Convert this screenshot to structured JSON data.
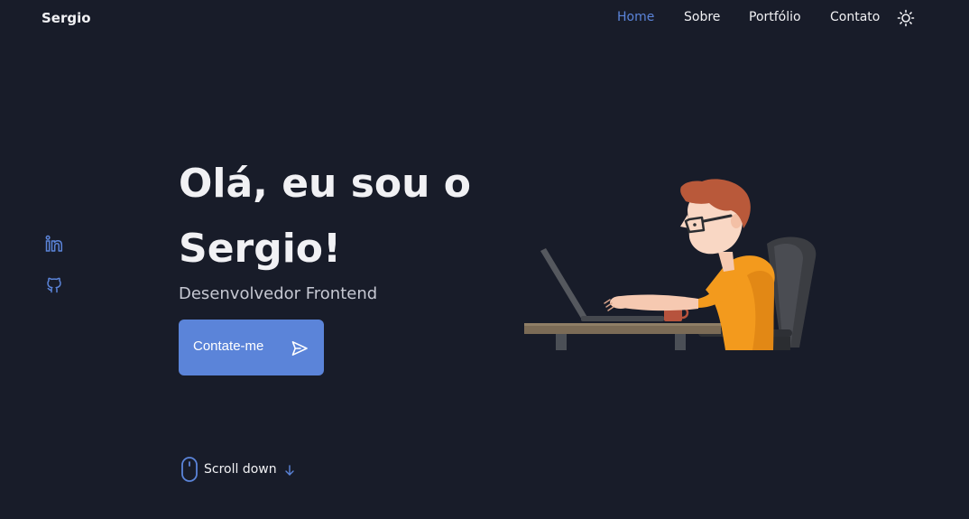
{
  "header": {
    "logo": "Sergio",
    "nav": [
      {
        "label": "Home",
        "active": true
      },
      {
        "label": "Sobre",
        "active": false
      },
      {
        "label": "Portfólio",
        "active": false
      },
      {
        "label": "Contato",
        "active": false
      }
    ],
    "theme_icon": "sun-icon"
  },
  "social": [
    {
      "icon": "linkedin-icon"
    },
    {
      "icon": "github-icon"
    }
  ],
  "hero": {
    "title_line1": "Olá, eu sou o",
    "title_line2": "Sergio!",
    "subtitle": "Desenvolvedor Frontend",
    "cta_label": "Contate-me",
    "cta_icon": "send-icon",
    "illustration": "developer-at-laptop-illustration"
  },
  "scroll": {
    "label": "Scroll down",
    "mouse_icon": "mouse-icon",
    "arrow_icon": "arrow-down-icon"
  },
  "colors": {
    "background": "#181c29",
    "accent": "#5b84d9",
    "text": "#f1f1f4",
    "subtext": "#c6c8d2"
  }
}
